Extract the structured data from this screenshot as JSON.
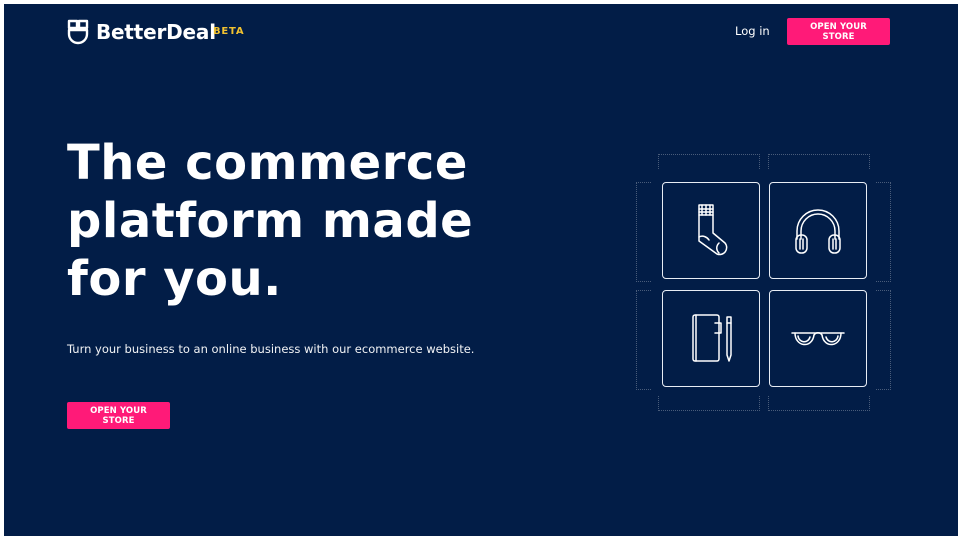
{
  "header": {
    "brand": "BetterDeal",
    "badge": "BETA",
    "login_label": "Log in",
    "cta_label": "OPEN YOUR STORE"
  },
  "hero": {
    "title_lines": [
      "The commerce",
      "platform made",
      "for you."
    ],
    "subtitle": "Turn your business to an online business with our ecommerce website.",
    "cta_label": "OPEN YOUR STORE"
  },
  "products": [
    {
      "icon": "sock-icon"
    },
    {
      "icon": "headphones-icon"
    },
    {
      "icon": "notebook-pen-icon"
    },
    {
      "icon": "glasses-icon"
    }
  ],
  "colors": {
    "background": "#021d47",
    "accent": "#ff1a78",
    "badge": "#f2c230",
    "text": "#ffffff"
  }
}
